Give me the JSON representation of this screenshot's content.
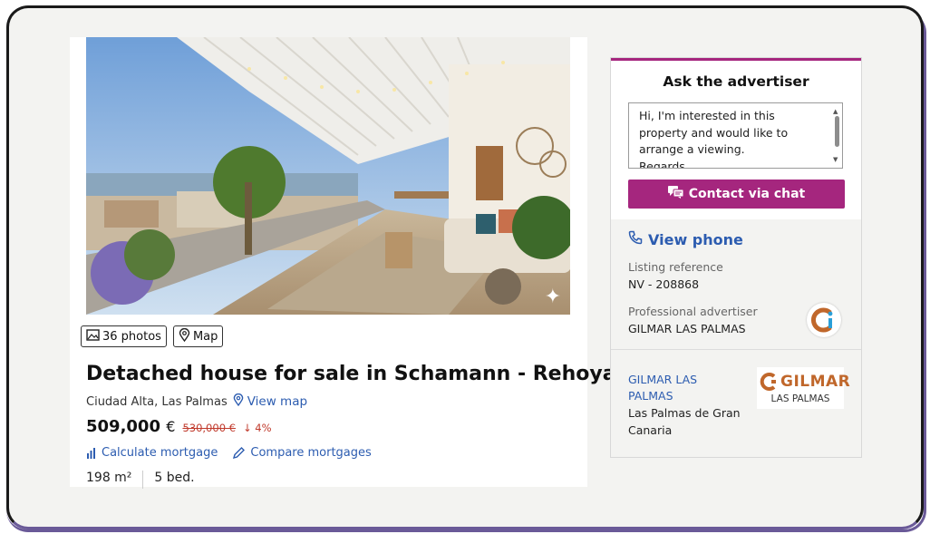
{
  "listing": {
    "photos_label": "36 photos",
    "map_label": "Map",
    "title": "Detached house for sale in Schamann - Rehoyas",
    "location": "Ciudad Alta, Las Palmas",
    "view_map": "View map",
    "price": "509,000",
    "currency": "€",
    "old_price": "530,000 €",
    "drop": "4%",
    "calc_mortgage": "Calculate mortgage",
    "compare_mortgages": "Compare mortgages",
    "area": "198 m²",
    "bedrooms": "5 bed."
  },
  "contact": {
    "heading": "Ask the advertiser",
    "message": "Hi, I'm interested in this property and would like to arrange a viewing.\nRegards",
    "chat_button": "Contact via chat",
    "view_phone": "View phone",
    "ref_label": "Listing reference",
    "ref_value": "NV - 208868",
    "adv_label": "Professional advertiser",
    "adv_value": "GILMAR LAS PALMAS",
    "agency_link": "GILMAR LAS PALMAS",
    "agency_city": "Las Palmas de Gran Canaria",
    "logo_top": "GILMAR",
    "logo_bottom": "LAS PALMAS"
  },
  "colors": {
    "accent": "#a5267e",
    "link": "#2c5cb0",
    "price_drop": "#c0392b"
  }
}
